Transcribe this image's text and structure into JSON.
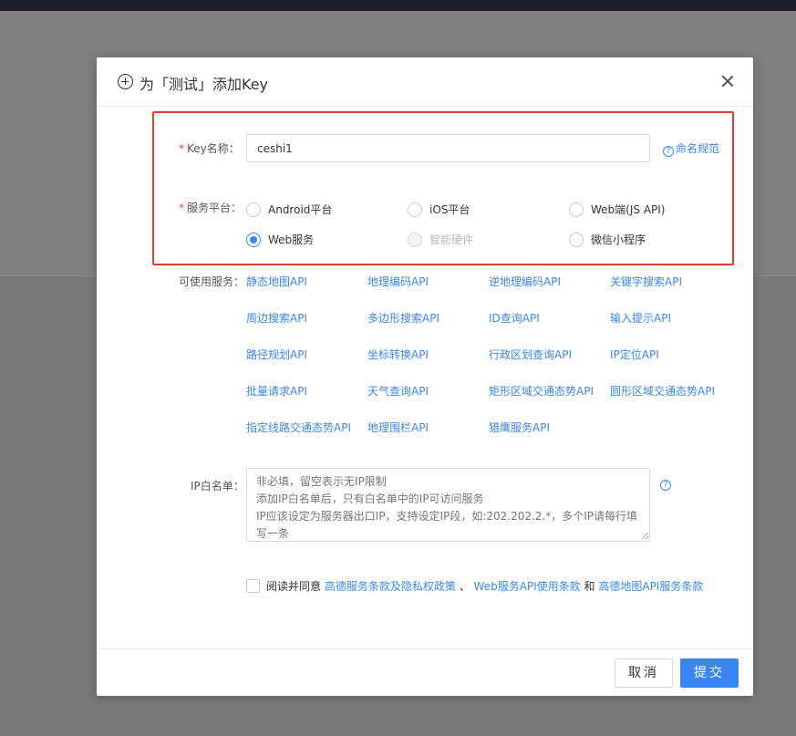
{
  "modal": {
    "title": "为「测试」添加Key",
    "close_icon": "close-icon",
    "header_icon": "plus-circle-icon"
  },
  "form": {
    "key_name": {
      "label": "Key名称",
      "required_mark": "*",
      "value": "ceshi1",
      "help_link": "命名规范",
      "help_icon": "question-circle-icon"
    },
    "platform": {
      "label": "服务平台",
      "required_mark": "*",
      "options": [
        {
          "label": "Android平台",
          "checked": false,
          "disabled": false
        },
        {
          "label": "iOS平台",
          "checked": false,
          "disabled": false
        },
        {
          "label": "Web端(JS API)",
          "checked": false,
          "disabled": false
        },
        {
          "label": "Web服务",
          "checked": true,
          "disabled": false
        },
        {
          "label": "智能硬件",
          "checked": false,
          "disabled": true
        },
        {
          "label": "微信小程序",
          "checked": false,
          "disabled": false
        }
      ]
    },
    "services": {
      "label": "可使用服务",
      "items": [
        "静态地图API",
        "地理编码API",
        "逆地理编码API",
        "关键字搜索API",
        "周边搜索API",
        "多边形搜索API",
        "ID查询API",
        "输入提示API",
        "路径规划API",
        "坐标转换API",
        "行政区划查询API",
        "IP定位API",
        "批量请求API",
        "天气查询API",
        "矩形区域交通态势API",
        "圆形区域交通态势API",
        "指定线路交通态势API",
        "地理围栏API",
        "猎鹰服务API"
      ]
    },
    "ip_whitelist": {
      "label": "IP白名单",
      "placeholder": "非必填，留空表示无IP限制\n添加IP白名单后，只有白名单中的IP可访问服务\nIP应该设定为服务器出口IP，支持设定IP段，如:202.202.2.*，多个IP请每行填写一条",
      "value": "",
      "help_icon": "question-circle-icon"
    },
    "agreement": {
      "checked": false,
      "prefix": "阅读并同意",
      "link1": "高德服务条款及隐私权政策",
      "sep1": "、",
      "link2": "Web服务API使用条款",
      "sep2": "和",
      "link3": "高德地图API服务条款"
    }
  },
  "footer": {
    "cancel_label": "取消",
    "submit_label": "提交"
  },
  "colors": {
    "accent": "#3a86f5",
    "required": "#f04134",
    "highlight_border": "#e53a2e",
    "overlay": "#7a7a7a"
  }
}
